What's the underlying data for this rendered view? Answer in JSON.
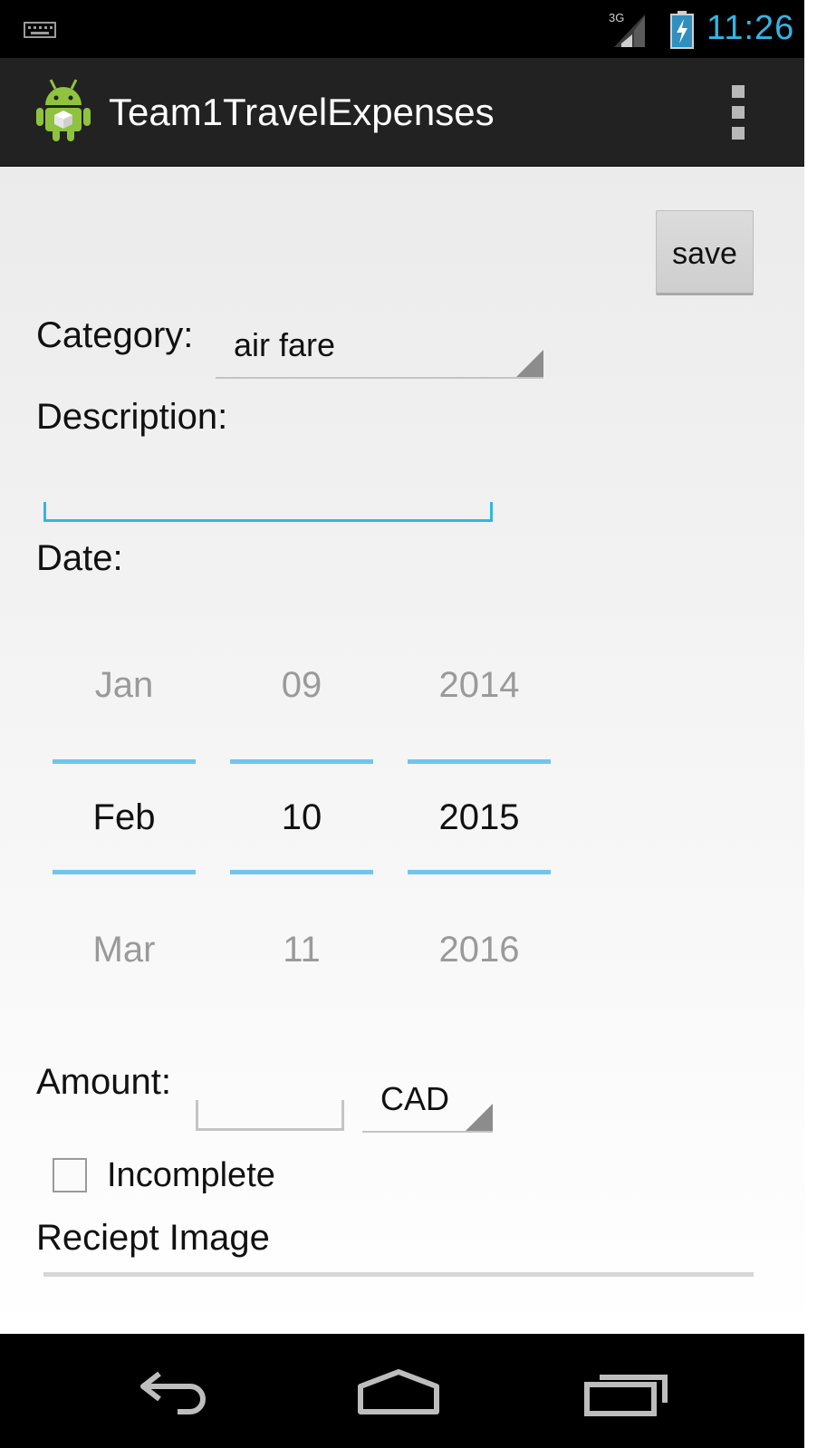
{
  "status_bar": {
    "network": "3G",
    "time": "11:26",
    "accent_color": "#33b5e5",
    "icons": [
      "keyboard-icon",
      "signal-icon",
      "battery-charging-icon"
    ]
  },
  "action_bar": {
    "app_icon": "android-app-icon",
    "title": "Team1TravelExpenses",
    "overflow_icon": "overflow-menu-icon"
  },
  "form": {
    "save_label": "save",
    "category_label": "Category:",
    "category_value": "air fare",
    "description_label": "Description:",
    "description_value": "",
    "date_label": "Date:",
    "date_picker": {
      "month": {
        "prev": "Jan",
        "current": "Feb",
        "next": "Mar"
      },
      "day": {
        "prev": "09",
        "current": "10",
        "next": "11"
      },
      "year": {
        "prev": "2014",
        "current": "2015",
        "next": "2016"
      }
    },
    "amount_label": "Amount:",
    "amount_value": "",
    "currency_value": "CAD",
    "incomplete_label": "Incomplete",
    "incomplete_checked": false,
    "receipt_label": "Reciept Image"
  },
  "nav_bar": {
    "icons": [
      "back-icon",
      "home-icon",
      "recent-apps-icon"
    ]
  }
}
